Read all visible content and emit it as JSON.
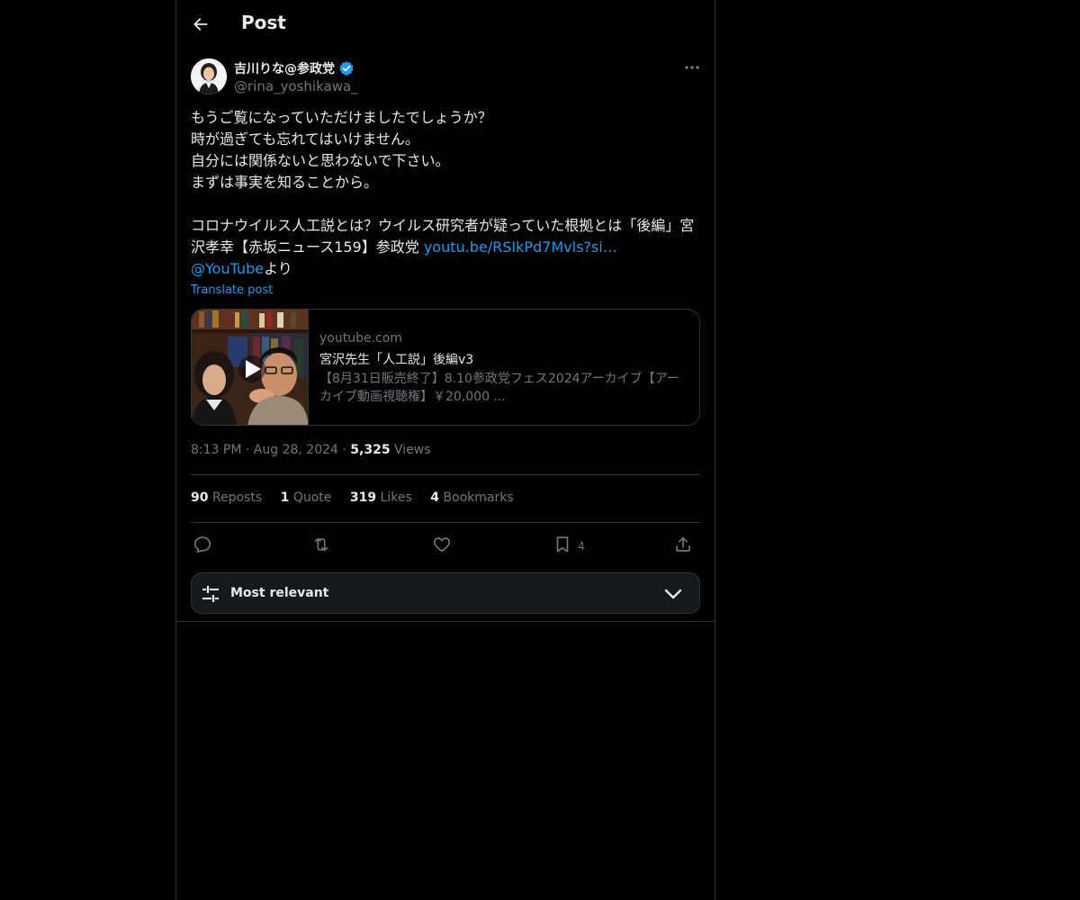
{
  "header": {
    "title": "Post"
  },
  "author": {
    "display_name": "吉川りな@参政党",
    "handle": "@rina_yoshikawa_",
    "verified": true
  },
  "tweet": {
    "text_main": "もうご覧になっていただけましたでしょうか？\n時が過ぎても忘れてはいけません。\n自分には関係ないと思わないで下さい。\nまずは事実を知ることから。\n\nコロナウイルス人工説とは？ウイルス研究者が疑っていた根拠とは「後編」宮沢孝幸【赤坂ニュース159】参政党 ",
    "link_text": "youtu.be/RSIkPd7Mvls?si…",
    "mention": "@YouTube",
    "text_tail": "より",
    "translate": "Translate post"
  },
  "card": {
    "domain": "youtube.com",
    "title": "宮沢先生「人工説」後編v3",
    "description": "【8月31日販売終了】8.10参政党フェス2024アーカイブ【アーカイブ動画視聴権】￥20,000 ..."
  },
  "meta": {
    "time": "8:13 PM",
    "sep": " · ",
    "date": "Aug 28, 2024",
    "views_count": "5,325",
    "views_label": "Views"
  },
  "stats": {
    "reposts_count": "90",
    "reposts_label": "Reposts",
    "quote_count": "1",
    "quote_label": "Quote",
    "likes_count": "319",
    "likes_label": "Likes",
    "bookmarks_count": "4",
    "bookmarks_label": "Bookmarks"
  },
  "actions": {
    "bookmark_count": "4"
  },
  "filter": {
    "label": "Most relevant"
  },
  "colors": {
    "accent": "#1d9bf0",
    "muted": "#71767b",
    "text": "#e7e9ea",
    "border": "#2f3336",
    "background": "#000000"
  },
  "icons": [
    "back-arrow-icon",
    "verified-badge-icon",
    "more-icon",
    "play-icon",
    "reply-icon",
    "repost-icon",
    "like-icon",
    "bookmark-icon",
    "share-icon",
    "sliders-icon",
    "chevron-down-icon"
  ]
}
